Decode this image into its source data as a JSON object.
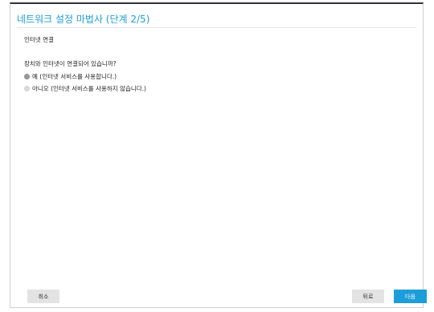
{
  "wizard": {
    "title": "네트워크 설정 마법사 (단계 2/5)",
    "section_title": "인터넷 연결",
    "question": "장치와 인터넷이 연결되어 있습니까?",
    "options": [
      {
        "label": "예 (인터넷 서비스를 사용합니다.)",
        "selected": true
      },
      {
        "label": "아니오 (인터넷 서비스를 사용하지 않습니다.)",
        "selected": false
      }
    ]
  },
  "footer": {
    "cancel_label": "취소",
    "back_label": "뒤로",
    "next_label": "다음"
  },
  "colors": {
    "accent": "#1e9ed8",
    "button_gray": "#e3e3e3",
    "radio_checked": "#9a9a9a",
    "radio_unchecked": "#dcdcdc"
  }
}
